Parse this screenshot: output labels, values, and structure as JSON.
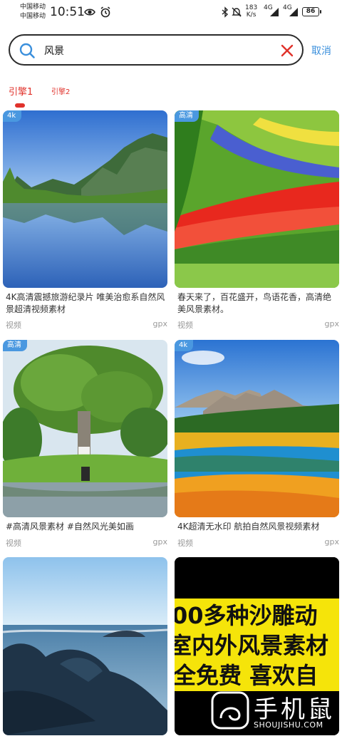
{
  "status_bar": {
    "carrier_1": "中国移动",
    "carrier_2": "中国移动",
    "time": "10:51",
    "net_speed_value": "183",
    "net_speed_unit": "K/s",
    "signal_1": "4G",
    "signal_2": "4G",
    "battery": "86"
  },
  "search": {
    "query": "风景",
    "cancel_label": "取消"
  },
  "tabs": [
    {
      "label": "引擎1",
      "active": true
    },
    {
      "label": "引擎2",
      "active": false
    }
  ],
  "results": [
    {
      "badge": "4k",
      "title": "4K高清震撼旅游纪录片 唯美治愈系自然风景超清视频素材",
      "type": "视频",
      "source": "gpx"
    },
    {
      "badge": "高清",
      "title": "春天来了，百花盛开，鸟语花香，高清绝美风景素材。",
      "type": "视频",
      "source": "gpx"
    },
    {
      "badge": "高清",
      "title": "#高清风景素材 #自然风光美如画",
      "type": "视频",
      "source": "gpx"
    },
    {
      "badge": "4k",
      "title": "4K超清无水印 航拍自然风景视频素材",
      "type": "视频",
      "source": "gpx"
    },
    {
      "badge": "",
      "title": "",
      "type": "",
      "source": ""
    },
    {
      "badge": "",
      "title": "",
      "type": "",
      "source": "",
      "poster_lines": [
        "00多种沙雕动",
        "室内外风景素材",
        "全免费 喜欢自"
      ]
    }
  ],
  "watermark": {
    "brand": "手机鼠",
    "url": "SHOUJISHU.COM"
  },
  "colors": {
    "accent": "#e0322b",
    "link": "#3a8fdc",
    "badge": "#4a98e0"
  }
}
